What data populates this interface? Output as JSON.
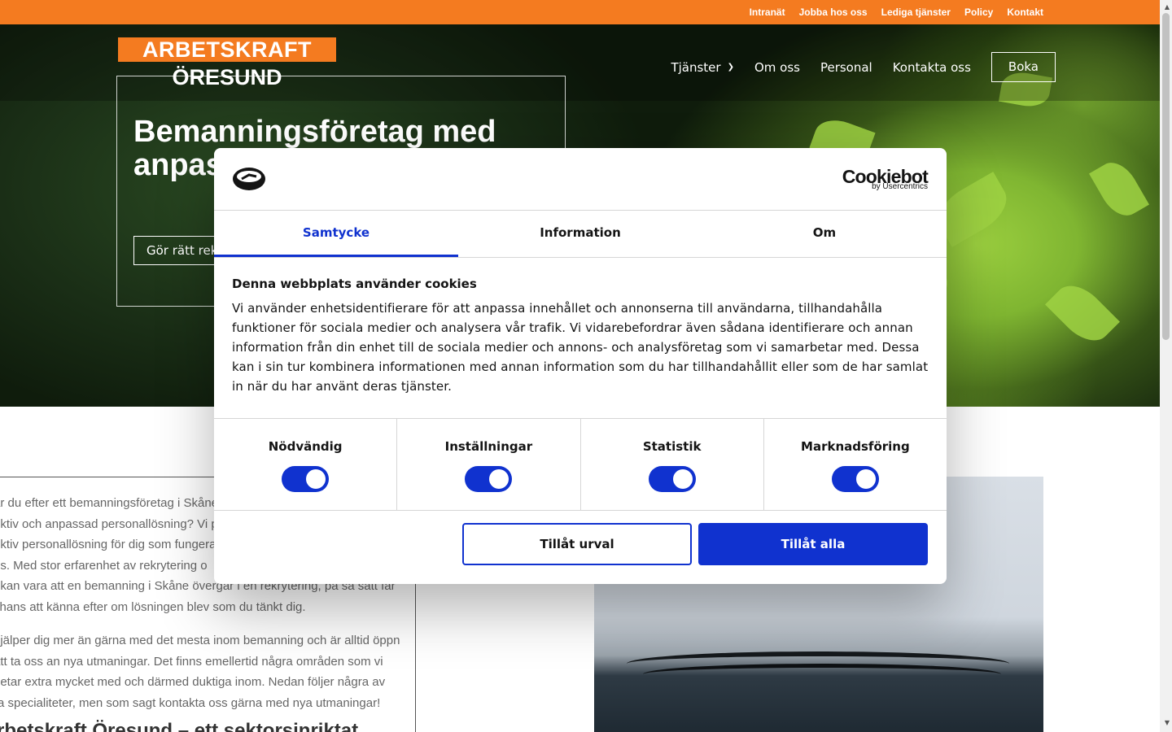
{
  "topbar": {
    "links": [
      "Intranät",
      "Jobba hos oss",
      "Lediga tjänster",
      "Policy",
      "Kontakt"
    ],
    "background": "#f47b20"
  },
  "header": {
    "logo_line1": "ARBETSKRAFT",
    "logo_line2": "ÖRESUND",
    "nav": [
      "Tjänster",
      "Om oss",
      "Personal",
      "Kontakta oss"
    ],
    "nav_dropdown_icon": "chevron-down-icon",
    "cta": "Boka"
  },
  "hero": {
    "title": "Bemanningsföretag med anpassad personal",
    "button": "Gör rätt rekrytering"
  },
  "content": {
    "paragraph1": [
      "ar du efter ett bemanningsföretag i Skåne",
      "ektiv och anpassad personallösning? Vi p",
      "ektiv personallösning för dig som fungera",
      "us. Med stor erfarenhet av rekrytering o",
      "t kan vara att en bemanning i Skåne övergår i en rekrytering, på så sätt får",
      "chans att känna efter om lösningen blev som du tänkt dig."
    ],
    "paragraph2": [
      "hjälper dig mer än gärna med det mesta inom bemanning och är alltid öppna",
      "att ta oss an nya utmaningar. Det finns emellertid några områden som vi",
      "betar extra mycket med och därmed duktiga inom. Nedan följer några av",
      "ra specialiteter, men som sagt kontakta oss gärna med nya utmaningar!"
    ],
    "heading": "rbetskraft Öresund – ett sektorsinriktat"
  },
  "cookie_dialog": {
    "brand": "Cookiebot",
    "brand_sub": "by Usercentrics",
    "tabs": [
      "Samtycke",
      "Information",
      "Om"
    ],
    "active_tab": "Samtycke",
    "title": "Denna webbplats använder cookies",
    "text": "Vi använder enhetsidentifierare för att anpassa innehållet och annonserna till användarna, tillhandahålla funktioner för sociala medier och analysera vår trafik. Vi vidarebefordrar även sådana identifierare och annan information från din enhet till de sociala medier och annons- och analysföretag som vi samarbetar med. Dessa kan i sin tur kombinera informationen med annan information som du har tillhandahållit eller som de har samlat in när du har använt deras tjänster.",
    "toggles": [
      {
        "label": "Nödvändig",
        "on": true
      },
      {
        "label": "Inställningar",
        "on": true
      },
      {
        "label": "Statistik",
        "on": true
      },
      {
        "label": "Marknadsföring",
        "on": true
      }
    ],
    "button_selection": "Tillåt urval",
    "button_all": "Tillåt alla",
    "accent": "#1032cf"
  }
}
